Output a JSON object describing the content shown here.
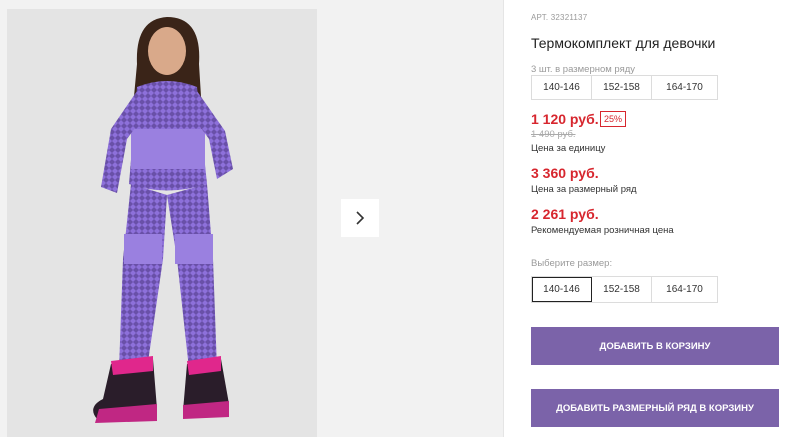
{
  "product": {
    "article": "АРТ. 32321137",
    "title": "Термокомплект для девочки"
  },
  "series_sizes": {
    "hint": "3 шт. в размерном ряду",
    "items": [
      "140-146",
      "152-158",
      "164-170"
    ]
  },
  "prices": {
    "unit_price": "1 120 руб.",
    "discount": "25%",
    "old_price": "1 490 руб.",
    "unit_caption": "Цена за единицу",
    "series_price": "3 360 руб.",
    "series_caption": "Цена за размерный ряд",
    "retail_price": "2 261 руб.",
    "retail_caption": "Рекомендуемая розничная цена"
  },
  "size_picker": {
    "hint": "Выберите размер:",
    "items": [
      "140-146",
      "152-158",
      "164-170"
    ],
    "selected": "140-146"
  },
  "buttons": {
    "add_to_cart": "ДОБАВИТЬ В КОРЗИНУ",
    "add_series_to_cart": "ДОБАВИТЬ РАЗМЕРНЫЙ РЯД В КОРЗИНУ"
  },
  "colors": {
    "accent": "#7b63a9",
    "price_red": "#d7262e",
    "suit_purple": "#8c6fd8"
  },
  "icons": {
    "next": "chevron-right-icon"
  }
}
